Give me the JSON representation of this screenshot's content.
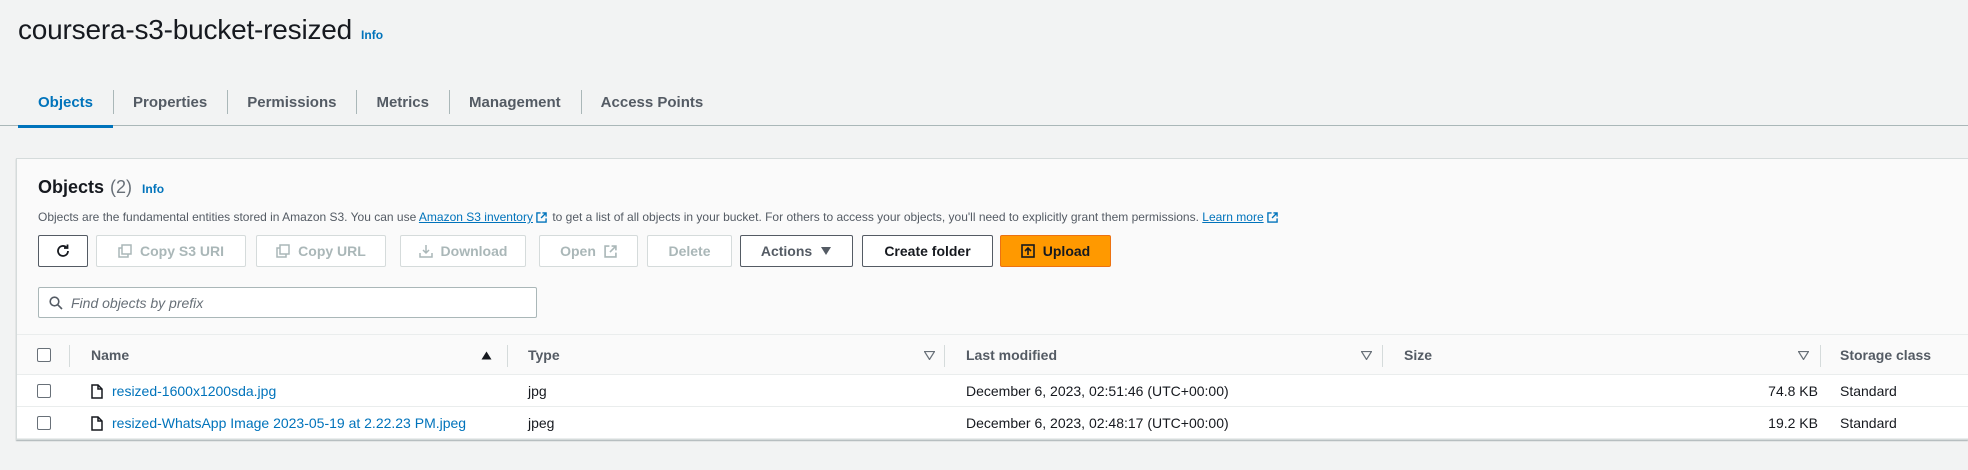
{
  "bucket": {
    "name": "coursera-s3-bucket-resized",
    "info_label": "Info"
  },
  "tabs": [
    {
      "label": "Objects",
      "active": true
    },
    {
      "label": "Properties"
    },
    {
      "label": "Permissions"
    },
    {
      "label": "Metrics"
    },
    {
      "label": "Management"
    },
    {
      "label": "Access Points"
    }
  ],
  "objects_panel": {
    "title": "Objects",
    "count": "(2)",
    "info_label": "Info",
    "description_prefix": "Objects are the fundamental entities stored in Amazon S3. You can use",
    "inventory_link": "Amazon S3 inventory",
    "description_middle": "to get a list of all objects in your bucket. For others to access your objects, you'll need to explicitly grant them permissions.",
    "learn_more_link": "Learn more"
  },
  "toolbar": {
    "copy_s3_uri": "Copy S3 URI",
    "copy_url": "Copy URL",
    "download": "Download",
    "open": "Open",
    "delete": "Delete",
    "actions": "Actions",
    "create_folder": "Create folder",
    "upload": "Upload"
  },
  "search": {
    "placeholder": "Find objects by prefix",
    "value": ""
  },
  "table": {
    "columns": {
      "name": "Name",
      "type": "Type",
      "last_modified": "Last modified",
      "size": "Size",
      "storage_class": "Storage class"
    },
    "rows": [
      {
        "name": "resized-1600x1200sda.jpg",
        "type": "jpg",
        "last_modified": "December 6, 2023, 02:51:46 (UTC+00:00)",
        "size": "74.8 KB",
        "storage_class": "Standard"
      },
      {
        "name": "resized-WhatsApp Image 2023-05-19 at 2.22.23 PM.jpeg",
        "type": "jpeg",
        "last_modified": "December 6, 2023, 02:48:17 (UTC+00:00)",
        "size": "19.2 KB",
        "storage_class": "Standard"
      }
    ]
  },
  "colors": {
    "link": "#0073bb",
    "primary_button": "#ff9900",
    "active_tab": "#0073bb"
  }
}
